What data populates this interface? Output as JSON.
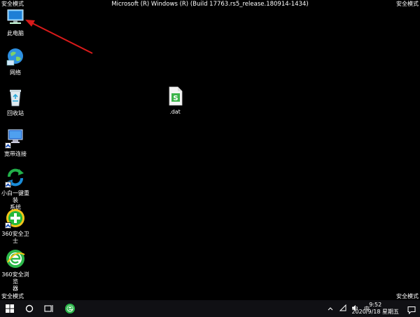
{
  "corners": {
    "top_left": "安全模式",
    "top_right": "安全模式",
    "bottom_left": "安全模式",
    "bottom_right": "安全模式"
  },
  "title": "Microsoft (R) Windows (R) (Build 17763.rs5_release.180914-1434)",
  "desktop_icons": {
    "this_pc": "此电脑",
    "network": "网络",
    "recycle_bin": "回收站",
    "broadband": "宽带连接",
    "reinstall_line1": "小白一键重装",
    "reinstall_line2": "系统",
    "guard": "360安全卫士",
    "browser_line1": "360安全浏览",
    "browser_line2": "器",
    "dat_file": ".dat"
  },
  "taskbar": {
    "time": "9:52",
    "date": "2020/9/18 星期五",
    "ime": "中"
  },
  "colors": {
    "accent_red": "#d91a1a",
    "green": "#20b020",
    "desktop": "#000000"
  }
}
